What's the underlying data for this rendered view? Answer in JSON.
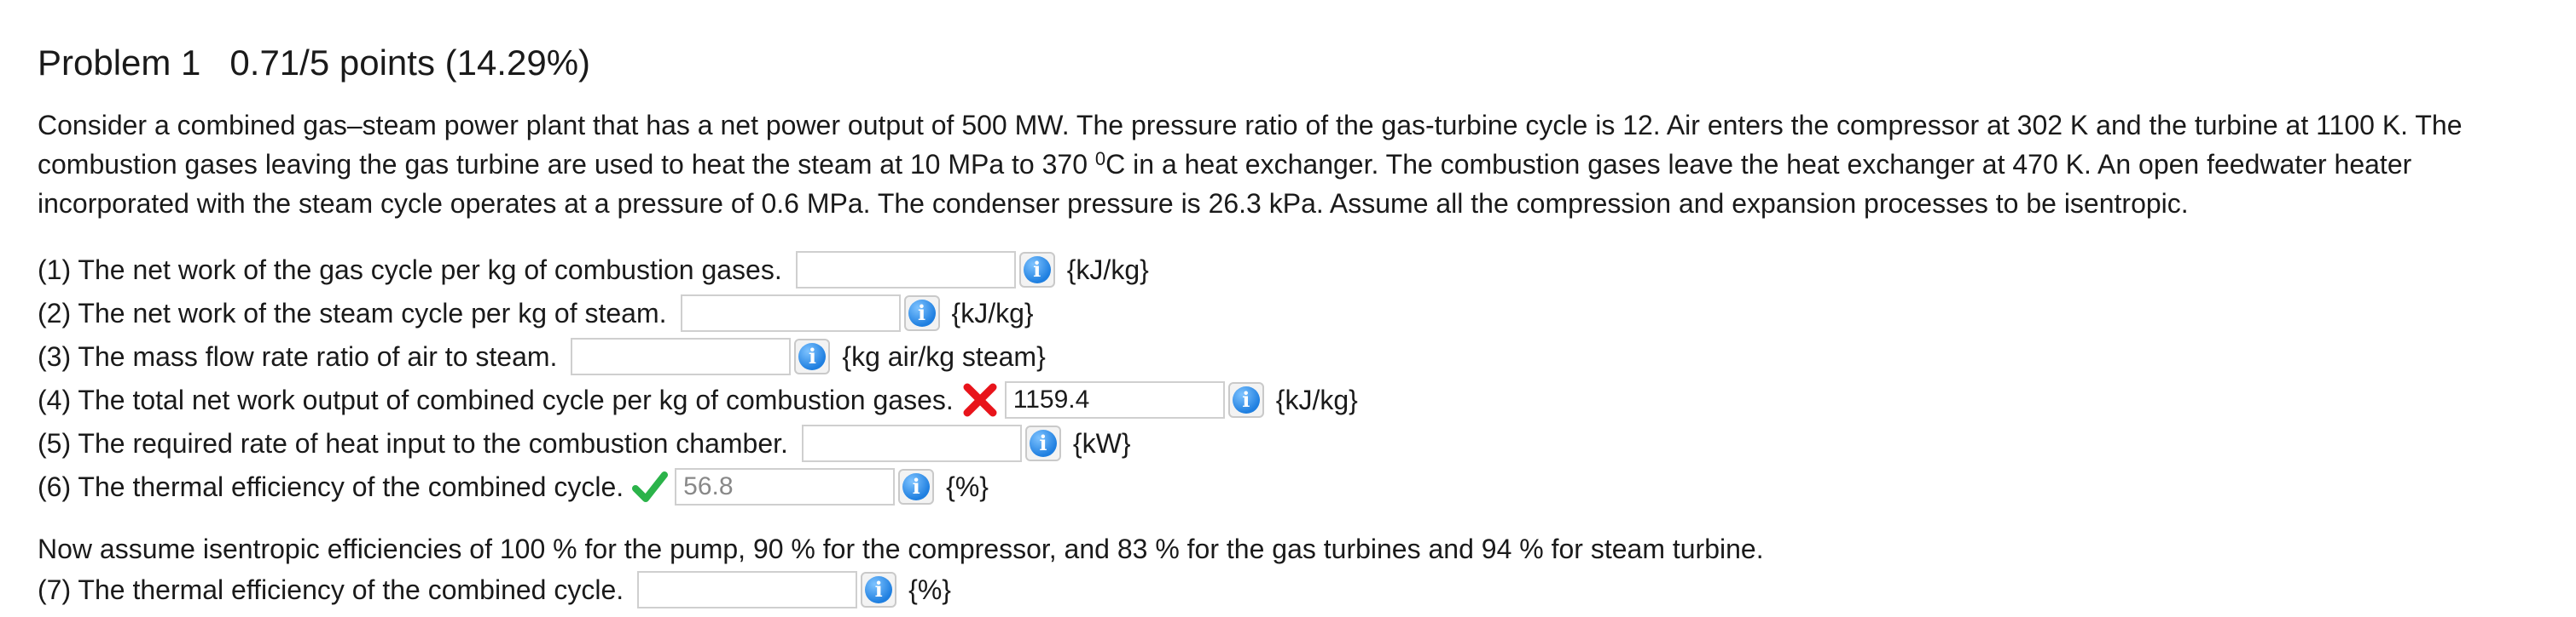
{
  "problem": {
    "title": "Problem 1",
    "points": "0.71/5 points (14.29%)"
  },
  "statement": {
    "part_a": "Consider a combined gas–steam power plant that has a net power output of 500 MW. The pressure ratio of the gas-turbine cycle is 12. Air enters the compressor at 302 K and the turbine at 1100 K. The combustion gases leaving the gas turbine are used to heat the steam at  10 MPa to 370 ",
    "degree": "0",
    "part_b": "C in a heat exchanger. The combustion gases leave the heat exchanger at 470 K. An open feedwater heater incorporated with the steam cycle operates at a pressure of 0.6 MPa. The condenser pressure is 26.3 kPa. Assume all the compression and expansion processes to be isentropic."
  },
  "questions": [
    {
      "text": "(1) The net work of the gas cycle per kg of combustion gases.",
      "value": "",
      "unit": "{kJ/kg}",
      "status": "none"
    },
    {
      "text": "(2) The net work of the steam cycle per kg of steam.",
      "value": "",
      "unit": "{kJ/kg}",
      "status": "none"
    },
    {
      "text": "(3) The mass flow rate ratio of air to steam.",
      "value": "",
      "unit": "{kg air/kg steam}",
      "status": "none"
    },
    {
      "text": "(4) The total net work output of combined cycle per kg of combustion gases.",
      "value": "1159.4",
      "unit": "{kJ/kg}",
      "status": "incorrect"
    },
    {
      "text": "(5) The required rate of heat input to the combustion chamber.",
      "value": "",
      "unit": "{kW}",
      "status": "none"
    },
    {
      "text": "(6) The thermal efficiency of the combined cycle.",
      "value": "56.8",
      "unit": "{%}",
      "status": "correct"
    }
  ],
  "part2": {
    "intro": "Now assume isentropic efficiencies of 100 % for the pump, 90 % for the compressor, and 83 % for the gas turbines and 94 % for steam turbine.",
    "question": {
      "text": "(7) The thermal efficiency of the combined cycle.",
      "value": "",
      "unit": "{%}",
      "status": "none"
    }
  },
  "icons": {
    "info": "info-icon",
    "incorrect": "red-x-icon",
    "correct": "green-checkmark-icon"
  },
  "colors": {
    "info_blue": "#1f7fe0",
    "incorrect_red": "#e8141b",
    "correct_green": "#2bb34a"
  }
}
